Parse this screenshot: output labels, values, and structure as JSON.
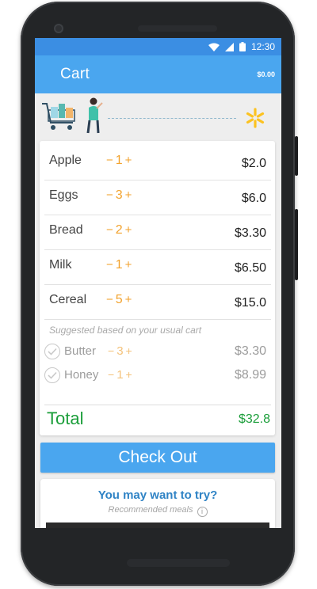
{
  "status_bar": {
    "time": "12:30"
  },
  "app_bar": {
    "title": "Cart",
    "total": "$0.00"
  },
  "cart": {
    "items": [
      {
        "name": "Apple",
        "qty": "1",
        "price": "$2.0"
      },
      {
        "name": "Eggs",
        "qty": "3",
        "price": "$6.0"
      },
      {
        "name": "Bread",
        "qty": "2",
        "price": "$3.30"
      },
      {
        "name": "Milk",
        "qty": "1",
        "price": "$6.50"
      },
      {
        "name": "Cereal",
        "qty": "5",
        "price": "$15.0"
      }
    ],
    "suggested_label": "Suggested based on your usual cart",
    "suggested": [
      {
        "name": "Butter",
        "qty": "3",
        "price": "$3.30"
      },
      {
        "name": "Honey",
        "qty": "1",
        "price": "$8.99"
      }
    ],
    "total_label": "Total",
    "total_value": "$32.8",
    "minus": "−",
    "plus": "+"
  },
  "checkout": {
    "label": "Check Out"
  },
  "try_card": {
    "title": "You may want to try?",
    "subtitle": "Recommended meals",
    "info_glyph": "i"
  },
  "icons": {
    "status": [
      "wifi-icon",
      "signal-icon",
      "battery-icon"
    ],
    "hero": [
      "shopping-cart-icon",
      "shopper-icon",
      "walmart-spark-icon"
    ]
  },
  "colors": {
    "app_bar": "#4aa6ef",
    "status_bar": "#3b8ee3",
    "quantity": "#f2a22c",
    "total": "#1b9e3a",
    "spark": "#fcc220"
  }
}
